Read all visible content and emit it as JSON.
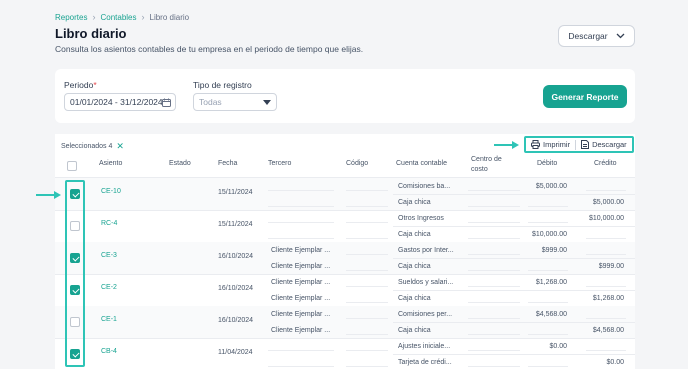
{
  "breadcrumb": {
    "item1": "Reportes",
    "item2": "Contables",
    "current": "Libro diario"
  },
  "page": {
    "title": "Libro diario",
    "subtitle": "Consulta los asientos contables de tu empresa en el periodo de tiempo que elijas.",
    "download_label": "Descargar"
  },
  "filters": {
    "period_label": "Periodo",
    "period_required": "*",
    "period_value": "01/01/2024 - 31/12/2024",
    "type_label": "Tipo de registro",
    "type_value": "Todas",
    "generate_label": "Generar Reporte"
  },
  "selection": {
    "text": "Seleccionados 4"
  },
  "toolbar": {
    "print_label": "Imprimir",
    "download_label": "Descargar"
  },
  "columns": {
    "asiento": "Asiento",
    "estado": "Estado",
    "fecha": "Fecha",
    "tercero": "Tercero",
    "codigo": "Código",
    "cuenta": "Cuenta contable",
    "centro1": "Centro de",
    "centro2": "costo",
    "debito": "Débito",
    "credito": "Crédito"
  },
  "rows": [
    {
      "code": "CE-10",
      "date": "15/11/2024",
      "checked": true,
      "lines": [
        {
          "tercero": "",
          "cuenta": "Comisiones ba...",
          "debito": "$5,000.00",
          "credito": ""
        },
        {
          "tercero": "",
          "cuenta": "Caja chica",
          "debito": "",
          "credito": "$5,000.00"
        }
      ]
    },
    {
      "code": "RC-4",
      "date": "15/11/2024",
      "checked": false,
      "lines": [
        {
          "tercero": "",
          "cuenta": "Otros Ingresos",
          "debito": "",
          "credito": "$10,000.00"
        },
        {
          "tercero": "",
          "cuenta": "Caja chica",
          "debito": "$10,000.00",
          "credito": ""
        }
      ]
    },
    {
      "code": "CE-3",
      "date": "16/10/2024",
      "checked": true,
      "lines": [
        {
          "tercero": "Cliente Ejemplar ...",
          "cuenta": "Gastos por Inter...",
          "debito": "$999.00",
          "credito": ""
        },
        {
          "tercero": "Cliente Ejemplar ...",
          "cuenta": "Caja chica",
          "debito": "",
          "credito": "$999.00"
        }
      ]
    },
    {
      "code": "CE-2",
      "date": "16/10/2024",
      "checked": true,
      "lines": [
        {
          "tercero": "Cliente Ejemplar ...",
          "cuenta": "Sueldos y salari...",
          "debito": "$1,268.00",
          "credito": ""
        },
        {
          "tercero": "Cliente Ejemplar ...",
          "cuenta": "Caja chica",
          "debito": "",
          "credito": "$1,268.00"
        }
      ]
    },
    {
      "code": "CE-1",
      "date": "16/10/2024",
      "checked": false,
      "lines": [
        {
          "tercero": "Cliente Ejemplar ...",
          "cuenta": "Comisiones per...",
          "debito": "$4,568.00",
          "credito": ""
        },
        {
          "tercero": "Cliente Ejemplar ...",
          "cuenta": "Caja chica",
          "debito": "",
          "credito": "$4,568.00"
        }
      ]
    },
    {
      "code": "CB-4",
      "date": "11/04/2024",
      "checked": true,
      "lines": [
        {
          "tercero": "",
          "cuenta": "Ajustes iniciale...",
          "debito": "$0.00",
          "credito": ""
        },
        {
          "tercero": "",
          "cuenta": "Tarjeta de crédi...",
          "debito": "",
          "credito": "$0.00"
        }
      ]
    }
  ],
  "colors": {
    "accent": "#17a391",
    "highlight": "#2ec4b6"
  }
}
